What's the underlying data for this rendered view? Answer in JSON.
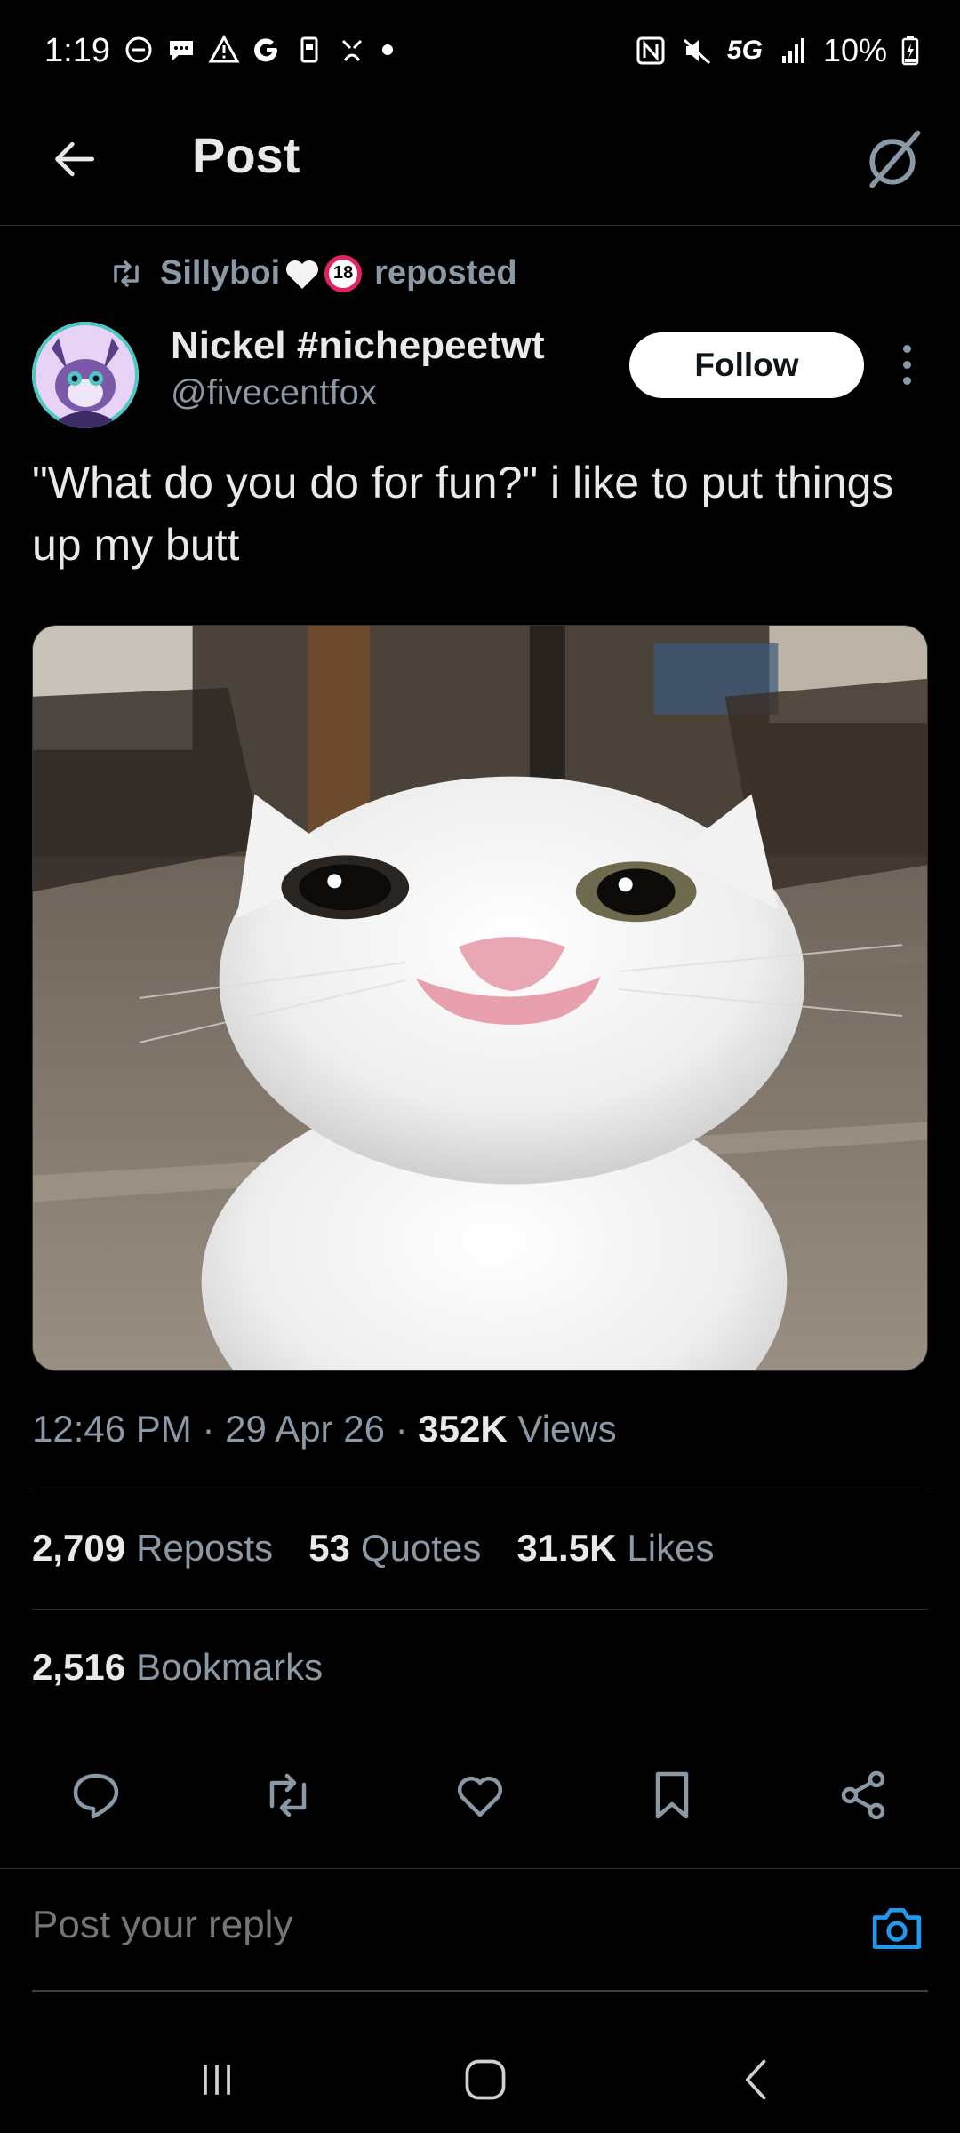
{
  "status_bar": {
    "time": "1:19",
    "network": "5G",
    "battery": "10%"
  },
  "header": {
    "title": "Post"
  },
  "repost": {
    "reposter": "Sillyboi",
    "label": "reposted",
    "badge": "18"
  },
  "author": {
    "name": "Nickel #nichepeetwt",
    "handle": "@fivecentfox",
    "follow_label": "Follow"
  },
  "post": {
    "text": "\"What do you do for fun?\" i like to put things up my butt",
    "time": "12:46 PM",
    "date": "29 Apr 26",
    "views_count": "352K",
    "views_label": "Views"
  },
  "stats": {
    "reposts_count": "2,709",
    "reposts_label": "Reposts",
    "quotes_count": "53",
    "quotes_label": "Quotes",
    "likes_count": "31.5K",
    "likes_label": "Likes",
    "bookmarks_count": "2,516",
    "bookmarks_label": "Bookmarks"
  },
  "reply": {
    "placeholder": "Post your reply"
  },
  "colors": {
    "background": "#000000",
    "text": "#e7e9ea",
    "secondary_text": "#8b98a5",
    "accent": "#1d9bf0",
    "divider": "#2f3336"
  }
}
